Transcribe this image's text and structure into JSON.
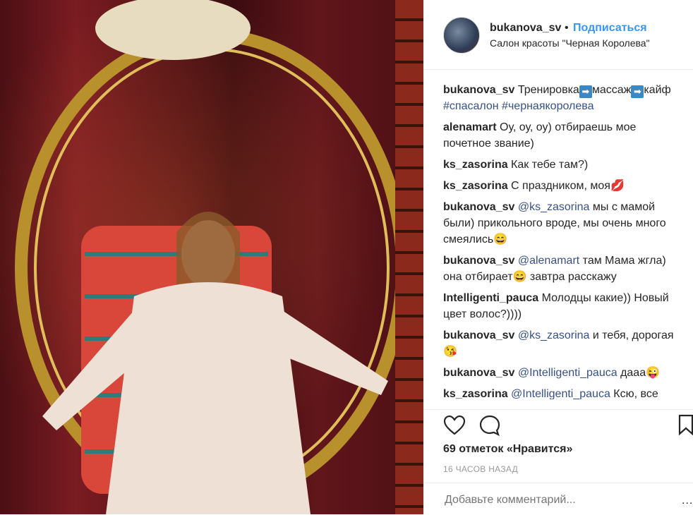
{
  "header": {
    "username": "bukanova_sv",
    "dot": "•",
    "follow_label": "Подписаться",
    "location": "Салон красоты \"Черная Королева\""
  },
  "comments": [
    {
      "user": "bukanova_sv",
      "parts": [
        {
          "t": " Тренировка"
        },
        {
          "a": "➡"
        },
        {
          "t": "массаж"
        },
        {
          "a": "➡"
        },
        {
          "t": "кайф "
        },
        {
          "m": "#спасалон #чернаякоролева"
        }
      ]
    },
    {
      "user": "alenamart",
      "parts": [
        {
          "t": " Оу, оу, оу) отбираешь мое почетное звание)"
        }
      ]
    },
    {
      "user": "ks_zasorina",
      "parts": [
        {
          "t": " Как тебе там?)"
        }
      ]
    },
    {
      "user": "ks_zasorina",
      "parts": [
        {
          "t": " С праздником, моя💋"
        }
      ]
    },
    {
      "user": "bukanova_sv",
      "parts": [
        {
          "m": " @ks_zasorina"
        },
        {
          "t": " мы с мамой были) прикольного вроде, мы очень много смеялись😄"
        }
      ]
    },
    {
      "user": "bukanova_sv",
      "parts": [
        {
          "m": " @alenamart"
        },
        {
          "t": " там Мама жгла) она отбирает😄 завтра расскажу"
        }
      ]
    },
    {
      "user": "Intelligenti_pauca",
      "parts": [
        {
          "t": " Молодцы какие)) Новый цвет волос?))))"
        }
      ]
    },
    {
      "user": "bukanova_sv",
      "parts": [
        {
          "m": " @ks_zasorina"
        },
        {
          "t": " и тебя, дорогая😘"
        }
      ]
    },
    {
      "user": "bukanova_sv",
      "parts": [
        {
          "m": " @Intelligenti_pauca"
        },
        {
          "t": " дааа😜"
        }
      ]
    },
    {
      "user": "ks_zasorina",
      "parts": [
        {
          "m": " @Intelligenti_pauca"
        },
        {
          "t": " Ксю, все"
        }
      ]
    }
  ],
  "likes": "69 отметок «Нравится»",
  "time": "16 ЧАСОВ НАЗАД",
  "add_comment_placeholder": "Добавьте комментарий...",
  "more": "...",
  "colors": {
    "link": "#3897f0",
    "mention": "#385185",
    "text": "#262626",
    "muted": "#999999"
  },
  "icons": [
    "heart-icon",
    "comment-icon",
    "bookmark-icon"
  ]
}
